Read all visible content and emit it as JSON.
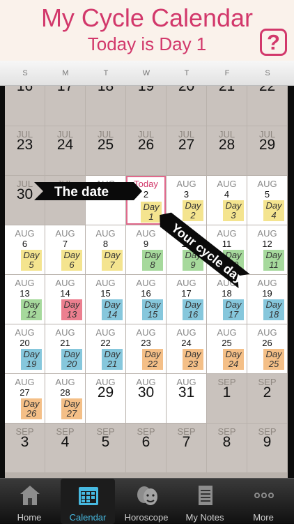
{
  "header": {
    "title": "My Cycle Calendar",
    "subtitle": "Today is Day 1",
    "help": "?"
  },
  "weekdays": [
    "S",
    "M",
    "T",
    "W",
    "T",
    "F",
    "S"
  ],
  "rows": [
    [
      {
        "d": "16",
        "g": 1
      },
      {
        "d": "17",
        "g": 1
      },
      {
        "d": "18",
        "g": 1
      },
      {
        "d": "19",
        "g": 1
      },
      {
        "d": "20",
        "g": 1
      },
      {
        "d": "21",
        "g": 1
      },
      {
        "d": "22",
        "g": 1
      }
    ],
    [
      {
        "m": "JUL",
        "d": "23",
        "g": 1
      },
      {
        "m": "JUL",
        "d": "24",
        "g": 1
      },
      {
        "m": "JUL",
        "d": "25",
        "g": 1
      },
      {
        "m": "JUL",
        "d": "26",
        "g": 1
      },
      {
        "m": "JUL",
        "d": "27",
        "g": 1
      },
      {
        "m": "JUL",
        "d": "28",
        "g": 1
      },
      {
        "m": "JUL",
        "d": "29",
        "g": 1
      }
    ],
    [
      {
        "m": "JUL",
        "d": "30",
        "g": 1
      },
      {
        "m": "JUL",
        "d": "31",
        "g": 1
      },
      {
        "m": "AUG",
        "d": "1",
        "g": 0
      },
      {
        "m": "Today",
        "d": "2",
        "g": 0,
        "t": 1,
        "day": "1",
        "c": "gold"
      },
      {
        "m": "AUG",
        "d": "3",
        "g": 0,
        "day": "2",
        "c": "gold"
      },
      {
        "m": "AUG",
        "d": "4",
        "g": 0,
        "day": "3",
        "c": "gold"
      },
      {
        "m": "AUG",
        "d": "5",
        "g": 0,
        "day": "4",
        "c": "gold"
      }
    ],
    [
      {
        "m": "AUG",
        "d": "6",
        "day": "5",
        "c": "gold"
      },
      {
        "m": "AUG",
        "d": "7",
        "day": "6",
        "c": "gold"
      },
      {
        "m": "AUG",
        "d": "8",
        "day": "7",
        "c": "gold"
      },
      {
        "m": "AUG",
        "d": "9",
        "day": "8",
        "c": "green"
      },
      {
        "m": "AUG",
        "d": "10",
        "day": "9",
        "c": "green"
      },
      {
        "m": "AUG",
        "d": "11",
        "day": "10",
        "c": "green"
      },
      {
        "m": "AUG",
        "d": "12",
        "day": "11",
        "c": "green"
      }
    ],
    [
      {
        "m": "AUG",
        "d": "13",
        "day": "12",
        "c": "green"
      },
      {
        "m": "AUG",
        "d": "14",
        "day": "13",
        "c": "red"
      },
      {
        "m": "AUG",
        "d": "15",
        "day": "14",
        "c": "blue"
      },
      {
        "m": "AUG",
        "d": "16",
        "day": "15",
        "c": "blue"
      },
      {
        "m": "AUG",
        "d": "17",
        "day": "16",
        "c": "blue"
      },
      {
        "m": "AUG",
        "d": "18",
        "day": "17",
        "c": "blue"
      },
      {
        "m": "AUG",
        "d": "19",
        "day": "18",
        "c": "blue"
      }
    ],
    [
      {
        "m": "AUG",
        "d": "20",
        "day": "19",
        "c": "blue"
      },
      {
        "m": "AUG",
        "d": "21",
        "day": "20",
        "c": "blue"
      },
      {
        "m": "AUG",
        "d": "22",
        "day": "21",
        "c": "blue"
      },
      {
        "m": "AUG",
        "d": "23",
        "day": "22",
        "c": "orange"
      },
      {
        "m": "AUG",
        "d": "24",
        "day": "23",
        "c": "orange"
      },
      {
        "m": "AUG",
        "d": "25",
        "day": "24",
        "c": "orange"
      },
      {
        "m": "AUG",
        "d": "26",
        "day": "25",
        "c": "orange"
      }
    ],
    [
      {
        "m": "AUG",
        "d": "27",
        "day": "26",
        "c": "orange"
      },
      {
        "m": "AUG",
        "d": "28",
        "day": "27",
        "c": "orange"
      },
      {
        "m": "AUG",
        "d": "29",
        "big": 1
      },
      {
        "m": "AUG",
        "d": "30",
        "big": 1
      },
      {
        "m": "AUG",
        "d": "31",
        "big": 1
      },
      {
        "m": "SEP",
        "d": "1",
        "g": 1
      },
      {
        "m": "SEP",
        "d": "2",
        "g": 1
      }
    ],
    [
      {
        "m": "SEP",
        "d": "3",
        "g": 1
      },
      {
        "m": "SEP",
        "d": "4",
        "g": 1
      },
      {
        "m": "SEP",
        "d": "5",
        "g": 1
      },
      {
        "m": "SEP",
        "d": "6",
        "g": 1
      },
      {
        "m": "SEP",
        "d": "7",
        "g": 1
      },
      {
        "m": "SEP",
        "d": "8",
        "g": 1
      },
      {
        "m": "SEP",
        "d": "9",
        "g": 1
      }
    ]
  ],
  "day_word": "Day",
  "annotations": {
    "date": "The date",
    "cycle": "Your cycle day"
  },
  "tabs": [
    "Home",
    "Calendar",
    "Horoscope",
    "My Notes",
    "More"
  ],
  "colors": {
    "gold": "#f4e48f",
    "green": "#a6d99c",
    "red": "#ec7f8f",
    "blue": "#86c7dc",
    "orange": "#f4bf87",
    "accent": "#d2386b",
    "tab_active": "#47b9e0"
  }
}
